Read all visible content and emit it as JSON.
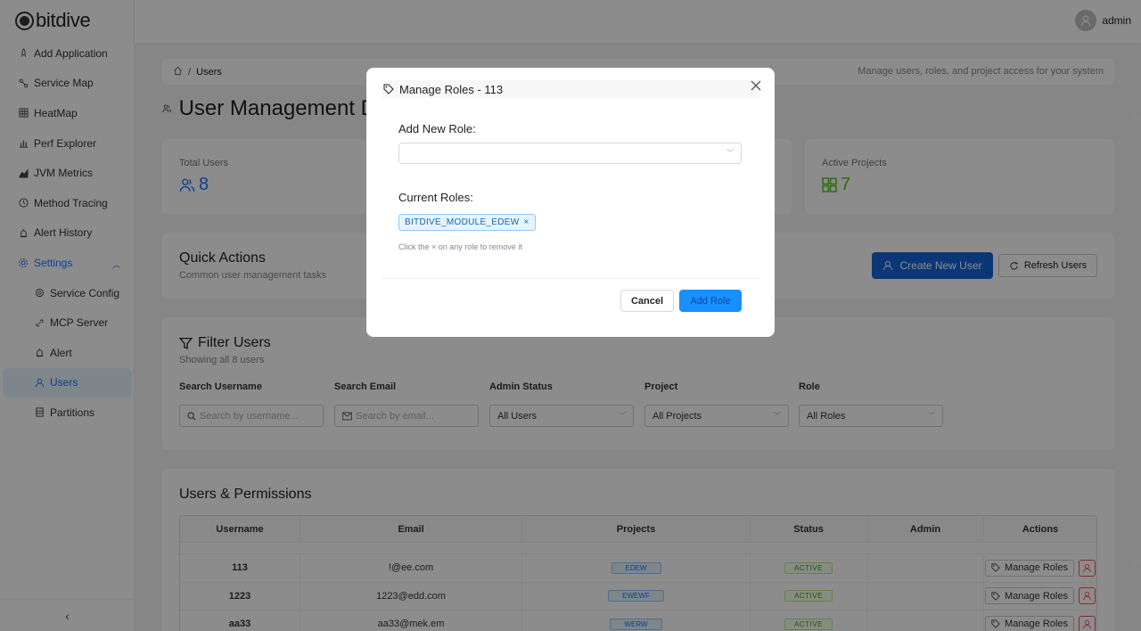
{
  "app": {
    "logo_text": "bitdive"
  },
  "sidebar": {
    "items": [
      {
        "label": "Add Application",
        "icon": "rocket-icon"
      },
      {
        "label": "Service Map",
        "icon": "map-icon"
      },
      {
        "label": "HeatMap",
        "icon": "grid-icon"
      },
      {
        "label": "Perf Explorer",
        "icon": "bar-chart-icon"
      },
      {
        "label": "JVM Metrics",
        "icon": "area-chart-icon"
      },
      {
        "label": "Method Tracing",
        "icon": "clock-icon"
      },
      {
        "label": "Alert History",
        "icon": "alarm-icon"
      },
      {
        "label": "Settings",
        "icon": "gear-icon"
      }
    ],
    "sub_items": [
      {
        "label": "Service Config",
        "icon": "cloud-icon"
      },
      {
        "label": "MCP Server",
        "icon": "link-icon"
      },
      {
        "label": "Alert",
        "icon": "alarm-icon"
      },
      {
        "label": "Users",
        "icon": "user-icon"
      },
      {
        "label": "Partitions",
        "icon": "partition-icon"
      }
    ],
    "active": "Users"
  },
  "header": {
    "username": "admin"
  },
  "breadcrumb": {
    "current": "Users",
    "description": "Manage users, roles, and project access for your system"
  },
  "page_title": "User Management D",
  "stats": {
    "total_users": {
      "label": "Total Users",
      "value": "8"
    },
    "active_projects": {
      "label": "Active Projects",
      "value": "7"
    }
  },
  "quick_actions": {
    "title": "Quick Actions",
    "subtitle": "Common user management tasks",
    "create_label": "Create New User",
    "refresh_label": "Refresh Users"
  },
  "filters": {
    "title": "Filter Users",
    "subtitle": "Showing all 8 users",
    "username_label": "Search Username",
    "username_placeholder": "Search by username...",
    "email_label": "Search Email",
    "email_placeholder": "Search by email...",
    "admin_label": "Admin Status",
    "admin_value": "All Users",
    "project_label": "Project",
    "project_value": "All Projects",
    "role_label": "Role",
    "role_value": "All Roles"
  },
  "table": {
    "title": "Users & Permissions",
    "columns": [
      "Username",
      "Email",
      "Projects",
      "Status",
      "Admin",
      "Actions"
    ],
    "rows": [
      {
        "username": "113",
        "email": "!@ee.com",
        "project": "EDEW",
        "status": "ACTIVE",
        "action": "Manage Roles"
      },
      {
        "username": "1223",
        "email": "1223@edd.com",
        "project": "EWEWF",
        "status": "ACTIVE",
        "action": "Manage Roles"
      },
      {
        "username": "aa33",
        "email": "aa33@mek.em",
        "project": "WERW",
        "status": "ACTIVE",
        "action": "Manage Roles"
      }
    ]
  },
  "modal": {
    "title": "Manage Roles - 113",
    "add_label": "Add New Role:",
    "current_label": "Current Roles:",
    "role_tag": "BITDIVE_MODULE_EDEW",
    "hint": "Click the × on any role to remove it",
    "cancel_label": "Cancel",
    "add_button_label": "Add Role"
  },
  "colors": {
    "primary": "#1765d9",
    "accent": "#1890ff",
    "stat_blue": "#1677ff",
    "stat_green": "#52c41a",
    "danger": "#ff4d4f"
  }
}
